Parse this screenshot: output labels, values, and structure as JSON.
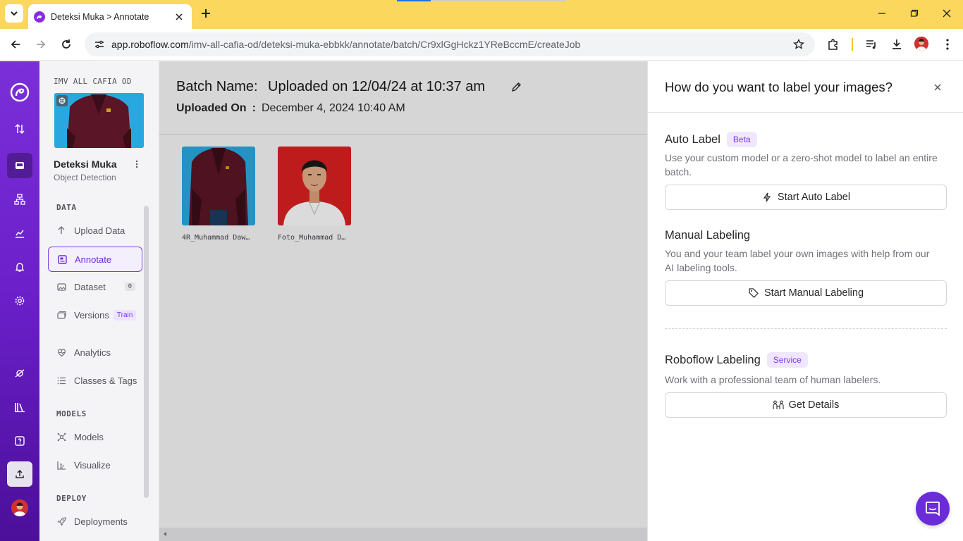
{
  "browser": {
    "tab_title": "Deteksi Muka > Annotate",
    "url_host": "app.roboflow.com",
    "url_path": "/imv-all-cafia-od/deteksi-muka-ebbkk/annotate/batch/Cr9xlGgHckz1YReBccmE/createJob"
  },
  "sidebar": {
    "workspace": "IMV ALL CAFIA OD",
    "project_name": "Deteksi Muka",
    "project_type": "Object Detection",
    "sections": {
      "data": "DATA",
      "models": "MODELS",
      "deploy": "DEPLOY"
    },
    "items": [
      {
        "label": "Upload Data"
      },
      {
        "label": "Annotate"
      },
      {
        "label": "Dataset",
        "badge": "0"
      },
      {
        "label": "Versions",
        "badge": "Train"
      },
      {
        "label": "Analytics"
      },
      {
        "label": "Classes & Tags"
      },
      {
        "label": "Models"
      },
      {
        "label": "Visualize"
      },
      {
        "label": "Deployments"
      }
    ]
  },
  "batch": {
    "name_label": "Batch Name:",
    "name_value": "Uploaded on 12/04/24 at 10:37 am",
    "uploaded_label": "Uploaded On",
    "uploaded_sep": ":",
    "uploaded_value": "December 4, 2024 10:40 AM",
    "images": [
      {
        "caption": "4R_Muhammad Daw…"
      },
      {
        "caption": "Foto_Muhammad D…"
      }
    ]
  },
  "panel": {
    "title": "How do you want to label your images?",
    "auto": {
      "title": "Auto Label",
      "pill": "Beta",
      "desc": "Use your custom model or a zero-shot model to label an entire batch.",
      "button": "Start Auto Label"
    },
    "manual": {
      "title": "Manual Labeling",
      "desc": "You and your team label your own images with help from our AI labeling tools.",
      "button": "Start Manual Labeling"
    },
    "service": {
      "title": "Roboflow Labeling",
      "pill": "Service",
      "desc": "Work with a professional team of human labelers.",
      "button": "Get Details"
    }
  },
  "colors": {
    "brand": "#6c2bd9",
    "tabbar": "#fbd75e",
    "accent_pill": "#7c3aed"
  }
}
